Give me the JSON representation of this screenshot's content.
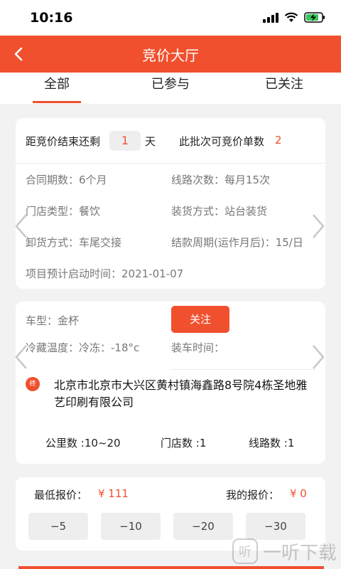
{
  "status": {
    "time": "10:16"
  },
  "nav": {
    "title": "竞价大厅"
  },
  "tabs": [
    {
      "label": "全部"
    },
    {
      "label": "已参与"
    },
    {
      "label": "已关注"
    }
  ],
  "summary": {
    "remain_label": "距竞价结束还剩",
    "remain_value": "1",
    "remain_unit": "天",
    "batch_label": "此批次可竞价单数",
    "batch_value": "2",
    "contract_period": "合同期数：6个月",
    "route_times": "线路次数：每月15次",
    "store_type": "门店类型：餐饮",
    "loading_method": "装货方式：站台装货",
    "unloading_method": "卸货方式：车尾交接",
    "payment_cycle": "结款周期(运作月后)：15/日",
    "start_time": "项目预计启动时间：2021-01-07"
  },
  "detail": {
    "vehicle_type": "车型：金杯",
    "follow_label": "关注",
    "cold_temp": "冷藏温度：冷冻：-18°c",
    "loading_time": "装车时间：",
    "loc_icon_text": "终",
    "address": "北京市北京市大兴区黄村镇海鑫路8号院4栋圣地雅艺印刷有限公司",
    "distance": "公里数 :10~20",
    "stores": "门店数 :1",
    "routes": "线路数 :1"
  },
  "quote": {
    "lowest_label": "最低报价：",
    "lowest_value": "¥ 111",
    "mine_label": "我的报价：",
    "mine_value": "¥ 0",
    "buttons": [
      "−5",
      "−10",
      "−20",
      "−30"
    ]
  },
  "watermark": {
    "text": "一听下载"
  },
  "colors": {
    "accent": "#f0502e",
    "background": "#f2f2f2"
  },
  "icons": {
    "status": [
      "cellular-signal-icon",
      "wifi-icon",
      "battery-charging-icon"
    ],
    "nav": "back-arrow-icon",
    "carousel": [
      "chevron-left-icon",
      "chevron-right-icon"
    ]
  }
}
